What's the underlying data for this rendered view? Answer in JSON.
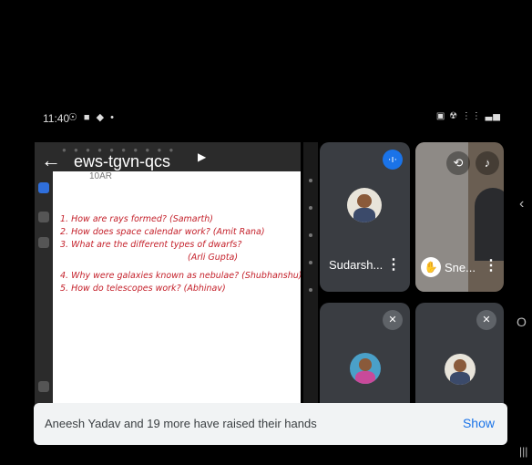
{
  "status_bar": {
    "time": "11:40",
    "left_icons": "☉ ■ ◆ •",
    "right_icons": "▣ ☢ ⋮⋮ ▃▅"
  },
  "meeting": {
    "code": "ews-tgvn-qcs"
  },
  "whiteboard": {
    "header": "10AR",
    "lines": [
      "1. How are rays formed? (Samarth)",
      "2. How does space calendar work? (Amit Rana)",
      "3. What are the different types of dwarfs?",
      "(Arli Gupta)",
      "4. Why were galaxies known as nebulae? (Shubhanshu)",
      "5. How do telescopes work? (Abhinav)"
    ]
  },
  "participants": [
    {
      "name": "Sudarsh...",
      "mic": "speaking"
    },
    {
      "name": "Sne...",
      "hand_raised": true
    },
    {
      "name": "",
      "mic": "muted"
    },
    {
      "name": "",
      "mic": "muted"
    }
  ],
  "snackbar": {
    "message": "Aneesh Yadav and 19 more have raised their hands",
    "action": "Show"
  },
  "colors": {
    "accent": "#1a73e8",
    "ink": "#c4202a",
    "tile": "#3a3d42"
  }
}
